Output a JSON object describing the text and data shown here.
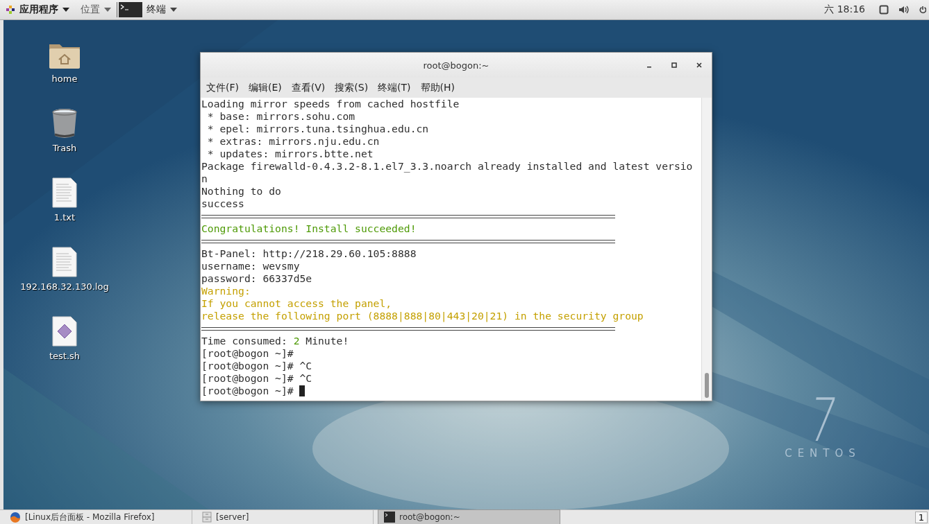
{
  "top_bar": {
    "applications": "应用程序",
    "places": "位置",
    "active_app": "终端",
    "clock": "六 18:16"
  },
  "desktop_icons": [
    {
      "label": "home",
      "kind": "folder"
    },
    {
      "label": "Trash",
      "kind": "trash"
    },
    {
      "label": "1.txt",
      "kind": "text"
    },
    {
      "label": "192.168.32.130.log",
      "kind": "text"
    },
    {
      "label": "test.sh",
      "kind": "script"
    }
  ],
  "terminal": {
    "title": "root@bogon:~",
    "menu": [
      "文件(F)",
      "编辑(E)",
      "查看(V)",
      "搜索(S)",
      "终端(T)",
      "帮助(H)"
    ],
    "lines": [
      {
        "kind": "text",
        "segments": [
          {
            "text": "Loading mirror speeds from cached hostfile",
            "kind": "normal"
          }
        ]
      },
      {
        "kind": "text",
        "segments": [
          {
            "text": " * base: mirrors.sohu.com",
            "kind": "normal"
          }
        ]
      },
      {
        "kind": "text",
        "segments": [
          {
            "text": " * epel: mirrors.tuna.tsinghua.edu.cn",
            "kind": "normal"
          }
        ]
      },
      {
        "kind": "text",
        "segments": [
          {
            "text": " * extras: mirrors.nju.edu.cn",
            "kind": "normal"
          }
        ]
      },
      {
        "kind": "text",
        "segments": [
          {
            "text": " * updates: mirrors.btte.net",
            "kind": "normal"
          }
        ]
      },
      {
        "kind": "text",
        "segments": [
          {
            "text": "Package firewalld-0.4.3.2-8.1.el7_3.3.noarch already installed and latest versio",
            "kind": "normal"
          }
        ]
      },
      {
        "kind": "text",
        "segments": [
          {
            "text": "n",
            "kind": "normal"
          }
        ]
      },
      {
        "kind": "text",
        "segments": [
          {
            "text": "Nothing to do",
            "kind": "normal"
          }
        ]
      },
      {
        "kind": "text",
        "segments": [
          {
            "text": "success",
            "kind": "normal"
          }
        ]
      },
      {
        "kind": "rule"
      },
      {
        "kind": "text",
        "segments": [
          {
            "text": "Congratulations! Install succeeded!",
            "kind": "success"
          }
        ]
      },
      {
        "kind": "rule"
      },
      {
        "kind": "text",
        "segments": [
          {
            "text": "Bt-Panel: http://218.29.60.105:8888",
            "kind": "normal"
          }
        ]
      },
      {
        "kind": "text",
        "segments": [
          {
            "text": "username: wevsmy",
            "kind": "normal"
          }
        ]
      },
      {
        "kind": "text",
        "segments": [
          {
            "text": "password: 66337d5e",
            "kind": "normal"
          }
        ]
      },
      {
        "kind": "text",
        "segments": [
          {
            "text": "Warning:",
            "kind": "warning"
          }
        ]
      },
      {
        "kind": "text",
        "segments": [
          {
            "text": "If you cannot access the panel,",
            "kind": "warning"
          }
        ]
      },
      {
        "kind": "text",
        "segments": [
          {
            "text": "release the following port (8888|888|80|443|20|21) in the security group",
            "kind": "warning"
          }
        ]
      },
      {
        "kind": "rule"
      },
      {
        "kind": "text",
        "segments": [
          {
            "text": "Time consumed: ",
            "kind": "normal"
          },
          {
            "text": "2",
            "kind": "success"
          },
          {
            "text": " Minute!",
            "kind": "normal"
          }
        ]
      },
      {
        "kind": "text",
        "segments": [
          {
            "text": "[root@bogon ~]# ",
            "kind": "normal"
          }
        ]
      },
      {
        "kind": "text",
        "segments": [
          {
            "text": "[root@bogon ~]# ^C",
            "kind": "normal"
          }
        ]
      },
      {
        "kind": "text",
        "segments": [
          {
            "text": "[root@bogon ~]# ^C",
            "kind": "normal"
          }
        ]
      },
      {
        "kind": "prompt",
        "segments": [
          {
            "text": "[root@bogon ~]# ",
            "kind": "normal"
          }
        ]
      }
    ]
  },
  "wallpaper": {
    "version": "7",
    "brand": "CENTOS"
  },
  "taskbar": {
    "items": [
      {
        "label": "[Linux后台面板 - Mozilla Firefox]",
        "kind": "browser",
        "selected": false
      },
      {
        "label": "[server]",
        "kind": "files",
        "selected": false
      },
      {
        "label": "root@bogon:~",
        "kind": "terminal",
        "selected": true
      }
    ],
    "workspace": "1"
  }
}
